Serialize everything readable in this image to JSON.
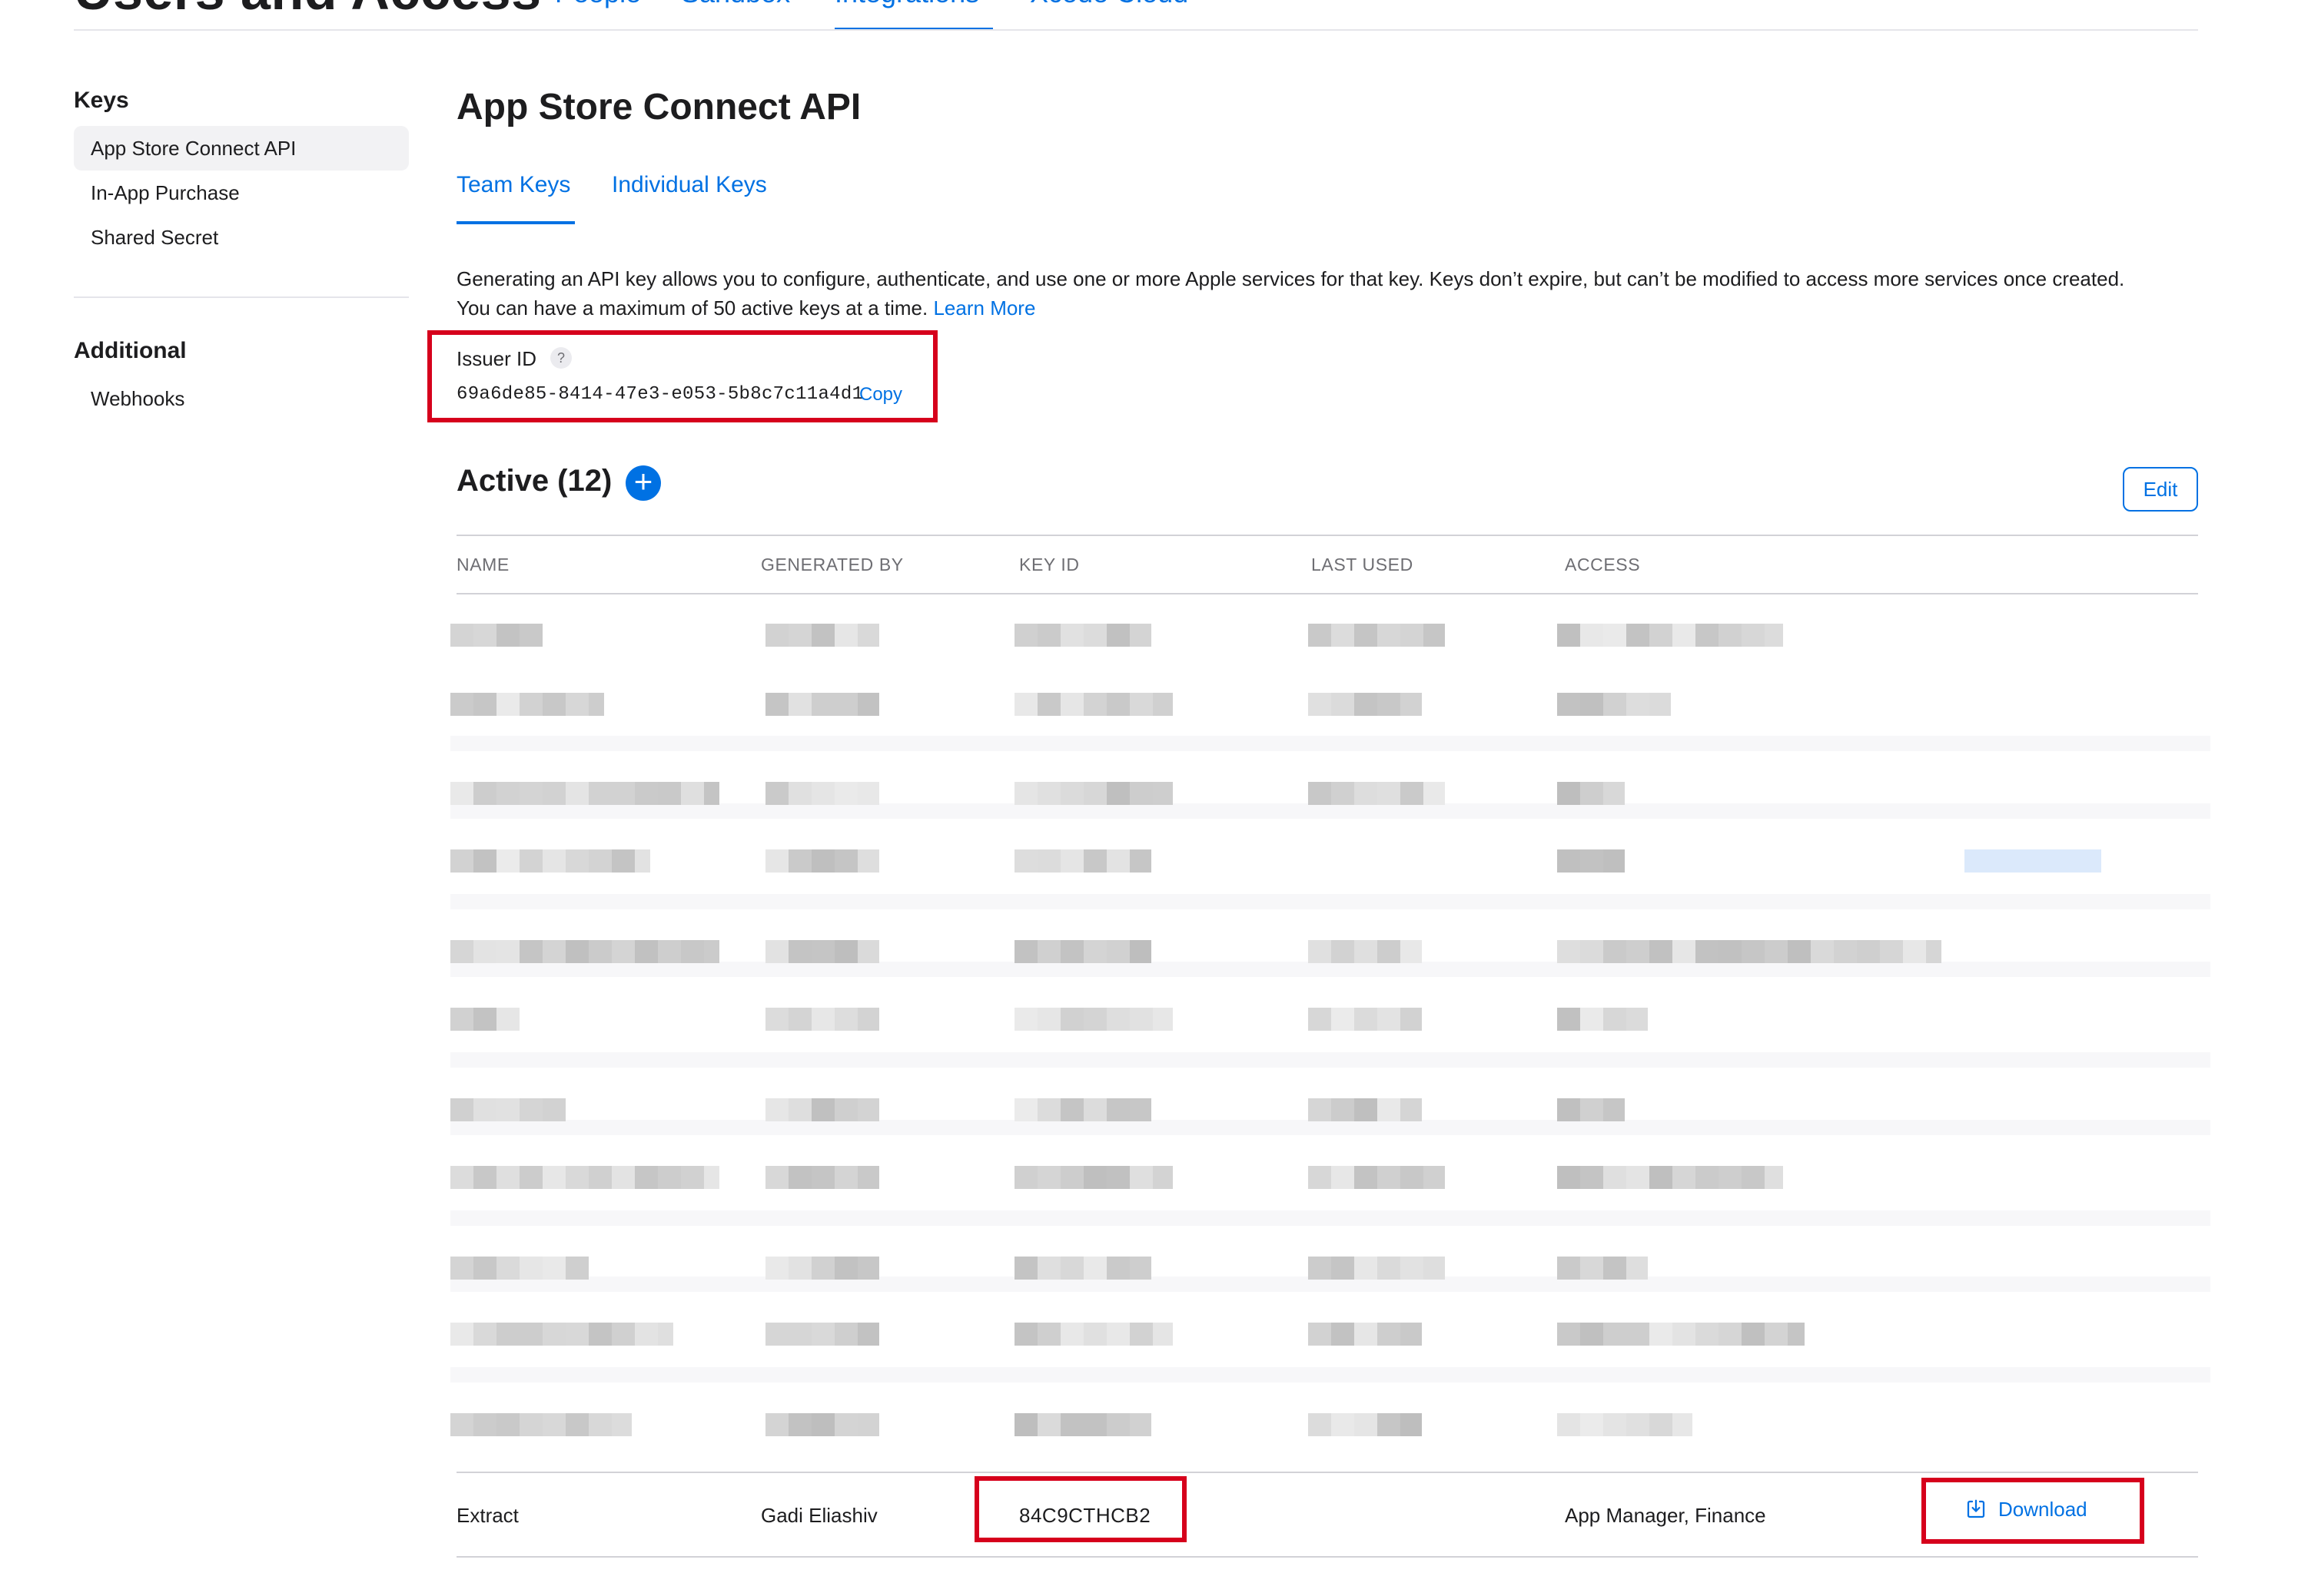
{
  "header": {
    "title": "Users and Access",
    "tabs": [
      {
        "label": "People"
      },
      {
        "label": "Sandbox"
      },
      {
        "label": "Integrations",
        "active": true
      },
      {
        "label": "Xcode Cloud"
      }
    ]
  },
  "sidebar": {
    "sections": [
      {
        "heading": "Keys",
        "items": [
          {
            "label": "App Store Connect API",
            "active": true
          },
          {
            "label": "In-App Purchase"
          },
          {
            "label": "Shared Secret"
          }
        ]
      },
      {
        "heading": "Additional",
        "items": [
          {
            "label": "Webhooks"
          }
        ]
      }
    ]
  },
  "main": {
    "title": "App Store Connect API",
    "subtabs": [
      {
        "label": "Team Keys",
        "active": true
      },
      {
        "label": "Individual Keys"
      }
    ],
    "description": "Generating an API key allows you to configure, authenticate, and use one or more Apple services for that key. Keys don’t expire, but can’t be modified to access more services once created. You can have a maximum of 50 active keys at a time.",
    "learn_more": "Learn More",
    "issuer": {
      "label": "Issuer ID",
      "help": "?",
      "value": "69a6de85-8414-47e3-e053-5b8c7c11a4d1",
      "copy_label": "Copy"
    },
    "active_heading": "Active (12)",
    "add_symbol": "+",
    "edit_label": "Edit",
    "table": {
      "columns": [
        "NAME",
        "GENERATED BY",
        "KEY ID",
        "LAST USED",
        "ACCESS"
      ],
      "visible_row": {
        "name": "Extract",
        "generated_by": "Gadi Eliashiv",
        "key_id": "84C9CTHCB2",
        "last_used": "",
        "access": "App Manager, Finance",
        "action": "Download"
      }
    }
  },
  "colors": {
    "accent": "#0071e3",
    "highlight_box": "#d6001c",
    "text": "#1d1d1f",
    "muted": "#6e6e73"
  }
}
